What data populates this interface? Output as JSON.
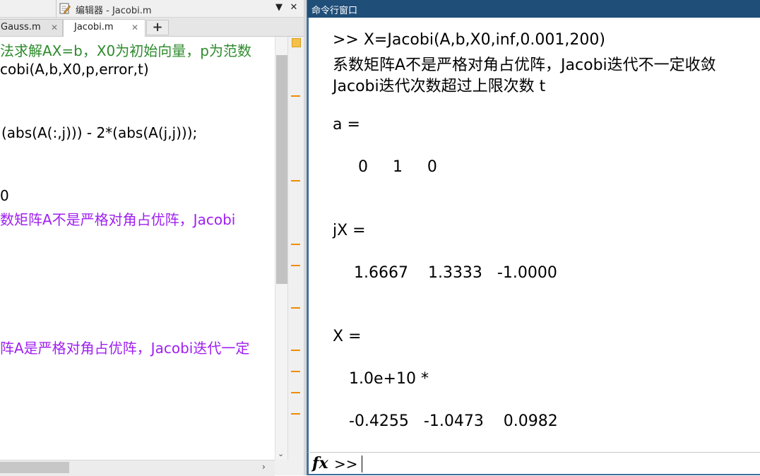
{
  "editor": {
    "title": "编辑器 - Jacobi.m",
    "tabs": [
      {
        "label": "Gauss.m",
        "close": "✕"
      },
      {
        "label": "Jacobi.m",
        "close": "✕"
      }
    ],
    "add_tab": "+",
    "menu_glyph": "▼",
    "close_glyph": "✕",
    "code_lines": [
      "法求解AX=b，X0为初始向量，p为范数",
      "cobi(A,b,X0,p,error,t)",
      "(abs(A(:,j))) - 2*(abs(A(j,j)));",
      "0",
      "数矩阵A不是严格对角占优阵，Jacobi",
      "阵A是严格对角占优阵，Jacobi迭代一定"
    ],
    "scroll_down_glyph": "⌄",
    "scroll_right_glyph": "›"
  },
  "command_window": {
    "title": "命令行窗口",
    "lines": [
      ">> X=Jacobi(A,b,X0,inf,0.001,200)",
      "系数矩阵A不是严格对角占优阵，Jacobi迭代不一定收敛",
      "Jacobi迭代次数超过上限次数 t",
      "a =",
      "0     1     0",
      "jX =",
      "1.6667    1.3333   -1.0000",
      "X =",
      "1.0e+10 *",
      "-0.4255   -1.0473    0.0982"
    ],
    "fx_label": "fx",
    "prompt": ">>"
  },
  "colors": {
    "comment": "#2e8b2e",
    "string": "#a020f0",
    "titlebar": "#1f4e79",
    "marker": "#f08c00"
  }
}
